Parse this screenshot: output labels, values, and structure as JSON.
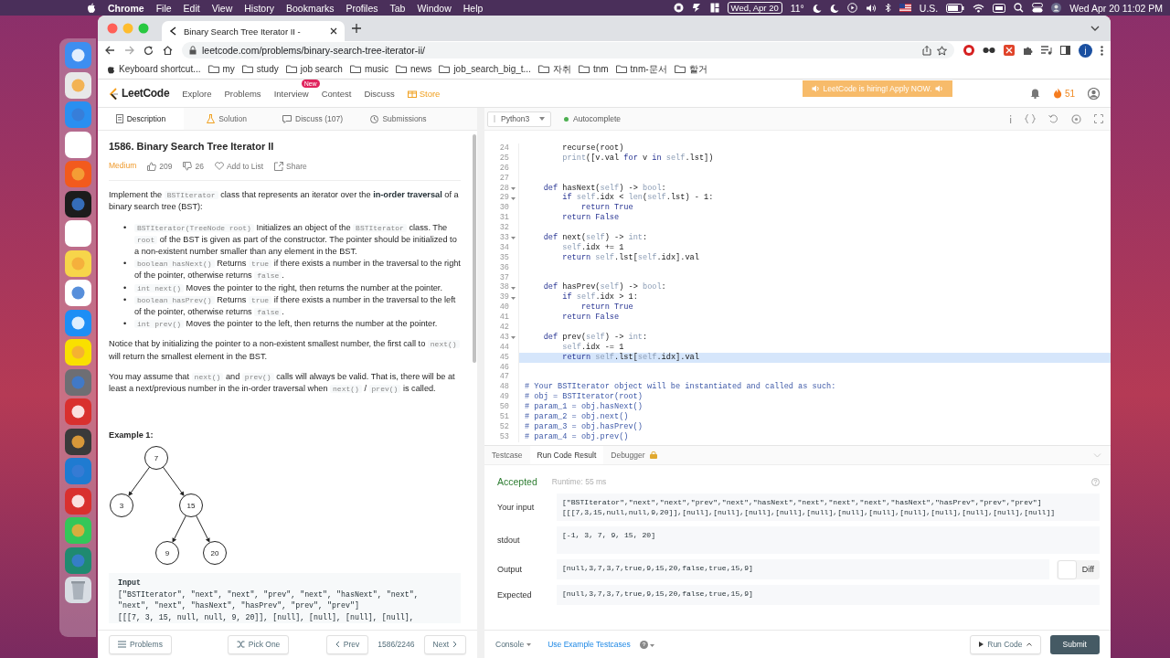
{
  "menu_bar": {
    "app": "Chrome",
    "items": [
      "File",
      "Edit",
      "View",
      "History",
      "Bookmarks",
      "Profiles",
      "Tab",
      "Window",
      "Help"
    ],
    "date_badge": "Wed, Apr 20",
    "weather": "11°",
    "input_source": "U.S.",
    "clock": "Wed Apr 20  11:02 PM"
  },
  "browser": {
    "tab_title": "Binary Search Tree Iterator II -",
    "url": "leetcode.com/problems/binary-search-tree-iterator-ii/",
    "profile": "j",
    "bookmarks": [
      {
        "kind": "page",
        "label": "Keyboard shortcut..."
      },
      {
        "kind": "folder",
        "label": "my"
      },
      {
        "kind": "folder",
        "label": "study"
      },
      {
        "kind": "folder",
        "label": "job search"
      },
      {
        "kind": "folder",
        "label": "music"
      },
      {
        "kind": "folder",
        "label": "news"
      },
      {
        "kind": "folder",
        "label": "job_search_big_t..."
      },
      {
        "kind": "folder",
        "label": "자취"
      },
      {
        "kind": "folder",
        "label": "tnm"
      },
      {
        "kind": "folder",
        "label": "tnm-문서"
      },
      {
        "kind": "folder",
        "label": "할거"
      }
    ]
  },
  "site_nav": {
    "logo": "LeetCode",
    "items": [
      {
        "kind": "link",
        "label": "Explore"
      },
      {
        "kind": "link",
        "label": "Problems"
      },
      {
        "kind": "link",
        "label": "Interview",
        "badge": "New"
      },
      {
        "kind": "link",
        "label": "Contest"
      },
      {
        "kind": "link",
        "label": "Discuss"
      },
      {
        "kind": "store",
        "label": "Store"
      }
    ],
    "banner": "LeetCode is hiring! Apply NOW.",
    "coins": "51"
  },
  "description_tabs": [
    {
      "label": "Description",
      "selected": true
    },
    {
      "label": "Solution",
      "selected": false
    },
    {
      "label": "Discuss (107)",
      "selected": false
    },
    {
      "label": "Submissions",
      "selected": false
    }
  ],
  "problem": {
    "title": "1586. Binary Search Tree Iterator II",
    "difficulty": "Medium",
    "likes": "209",
    "dislikes": "26",
    "add_to_list": "Add to List",
    "share": "Share",
    "body": [
      {
        "kind": "para",
        "segs": [
          {
            "kind": "text",
            "text": "Implement the "
          },
          {
            "kind": "code",
            "text": "BSTIterator"
          },
          {
            "kind": "text",
            "text": " class that represents an iterator over the "
          },
          {
            "kind": "strong",
            "text": "in-order traversal"
          },
          {
            "kind": "text",
            "text": " of a binary search tree (BST):"
          }
        ]
      },
      {
        "kind": "bullets",
        "marker": "•",
        "items": [
          [
            {
              "kind": "code",
              "text": "BSTIterator(TreeNode root)"
            },
            {
              "kind": "text",
              "text": " Initializes an object of the "
            },
            {
              "kind": "code",
              "text": "BSTIterator"
            },
            {
              "kind": "text",
              "text": " class. The "
            },
            {
              "kind": "code",
              "text": "root"
            },
            {
              "kind": "text",
              "text": " of the BST is given as part of the constructor. The pointer should be initialized to a non-existent number smaller than any element in the BST."
            }
          ],
          [
            {
              "kind": "code",
              "text": "boolean hasNext()"
            },
            {
              "kind": "text",
              "text": " Returns "
            },
            {
              "kind": "code",
              "text": "true"
            },
            {
              "kind": "text",
              "text": " if there exists a number in the traversal to the right of the pointer, otherwise returns "
            },
            {
              "kind": "code",
              "text": "false"
            },
            {
              "kind": "text",
              "text": "."
            }
          ],
          [
            {
              "kind": "code",
              "text": "int next()"
            },
            {
              "kind": "text",
              "text": " Moves the pointer to the right, then returns the number at the pointer."
            }
          ],
          [
            {
              "kind": "code",
              "text": "boolean hasPrev()"
            },
            {
              "kind": "text",
              "text": " Returns "
            },
            {
              "kind": "code",
              "text": "true"
            },
            {
              "kind": "text",
              "text": " if there exists a number in the traversal to the left of the pointer, otherwise returns "
            },
            {
              "kind": "code",
              "text": "false"
            },
            {
              "kind": "text",
              "text": "."
            }
          ],
          [
            {
              "kind": "code",
              "text": "int prev()"
            },
            {
              "kind": "text",
              "text": " Moves the pointer to the left, then returns the number at the pointer."
            }
          ]
        ]
      },
      {
        "kind": "para",
        "segs": [
          {
            "kind": "text",
            "text": "Notice that by initializing the pointer to a non-existent smallest number, the first call to "
          },
          {
            "kind": "code",
            "text": "next()"
          },
          {
            "kind": "text",
            "text": " will return the smallest element in the BST."
          }
        ]
      },
      {
        "kind": "para",
        "segs": [
          {
            "kind": "text",
            "text": "You may assume that "
          },
          {
            "kind": "code",
            "text": "next()"
          },
          {
            "kind": "text",
            "text": " and "
          },
          {
            "kind": "code",
            "text": "prev()"
          },
          {
            "kind": "text",
            "text": " calls will always be valid. That is, there will be at least a next/previous number in the in-order traversal when "
          },
          {
            "kind": "code",
            "text": "next()"
          },
          {
            "kind": "text",
            "text": " / "
          },
          {
            "kind": "code",
            "text": "prev()"
          },
          {
            "kind": "text",
            "text": " is called."
          }
        ]
      }
    ],
    "example_title": "Example 1:",
    "tree": {
      "label": "7",
      "children": [
        {
          "label": "3"
        },
        {
          "label": "15",
          "children": [
            {
              "label": "9"
            },
            {
              "label": "20"
            }
          ]
        }
      ]
    },
    "example_heading": "Input",
    "example_lines": [
      "[\"BSTIterator\", \"next\", \"next\", \"prev\", \"next\", \"hasNext\", \"next\",",
      "\"next\", \"next\", \"hasNext\", \"hasPrev\", \"prev\", \"prev\"]",
      "[[[7, 3, 15, null, null, 9, 20]], [null], [null], [null], [null],"
    ]
  },
  "left_footer": {
    "problems": "Problems",
    "pick_one": "Pick One",
    "prev": "Prev",
    "position": "1586/2246",
    "next": "Next"
  },
  "editor": {
    "language": "Python3",
    "autocomplete": "Autocomplete",
    "lines": [
      {
        "n": "24",
        "fold": false,
        "active": false,
        "segs": [
          {
            "kind": "plain",
            "text": "        recurse(root)"
          }
        ]
      },
      {
        "n": "25",
        "fold": false,
        "active": false,
        "segs": [
          {
            "kind": "builtin",
            "text": "        print"
          },
          {
            "kind": "plain",
            "text": "([v.val "
          },
          {
            "kind": "keyword",
            "text": "for"
          },
          {
            "kind": "plain",
            "text": " v "
          },
          {
            "kind": "keyword",
            "text": "in"
          },
          {
            "kind": "builtin",
            "text": " self"
          },
          {
            "kind": "plain",
            "text": ".lst])"
          }
        ]
      },
      {
        "n": "26",
        "fold": false,
        "active": false
      },
      {
        "n": "27",
        "fold": false,
        "active": false
      },
      {
        "n": "28",
        "fold": true,
        "active": false,
        "segs": [
          {
            "kind": "keyword",
            "text": "    def"
          },
          {
            "kind": "plain",
            "text": " hasNext("
          },
          {
            "kind": "builtin",
            "text": "self"
          },
          {
            "kind": "plain",
            "text": ") -> "
          },
          {
            "kind": "builtin",
            "text": "bool"
          },
          {
            "kind": "plain",
            "text": ":"
          }
        ]
      },
      {
        "n": "29",
        "fold": true,
        "active": false,
        "segs": [
          {
            "kind": "keyword",
            "text": "        if"
          },
          {
            "kind": "builtin",
            "text": " self"
          },
          {
            "kind": "plain",
            "text": ".idx < "
          },
          {
            "kind": "builtin",
            "text": "len"
          },
          {
            "kind": "plain",
            "text": "("
          },
          {
            "kind": "builtin",
            "text": "self"
          },
          {
            "kind": "plain",
            "text": ".lst) - 1:"
          }
        ]
      },
      {
        "n": "30",
        "fold": false,
        "active": false,
        "segs": [
          {
            "kind": "keyword",
            "text": "            return True"
          }
        ]
      },
      {
        "n": "31",
        "fold": false,
        "active": false,
        "segs": [
          {
            "kind": "keyword",
            "text": "        return False"
          }
        ]
      },
      {
        "n": "32",
        "fold": false,
        "active": false
      },
      {
        "n": "33",
        "fold": true,
        "active": false,
        "segs": [
          {
            "kind": "keyword",
            "text": "    def"
          },
          {
            "kind": "plain",
            "text": " next("
          },
          {
            "kind": "builtin",
            "text": "self"
          },
          {
            "kind": "plain",
            "text": ") -> "
          },
          {
            "kind": "builtin",
            "text": "int"
          },
          {
            "kind": "plain",
            "text": ":"
          }
        ]
      },
      {
        "n": "34",
        "fold": false,
        "active": false,
        "segs": [
          {
            "kind": "builtin",
            "text": "        self"
          },
          {
            "kind": "plain",
            "text": ".idx += 1"
          }
        ]
      },
      {
        "n": "35",
        "fold": false,
        "active": false,
        "segs": [
          {
            "kind": "keyword",
            "text": "        return"
          },
          {
            "kind": "builtin",
            "text": " self"
          },
          {
            "kind": "plain",
            "text": ".lst["
          },
          {
            "kind": "builtin",
            "text": "self"
          },
          {
            "kind": "plain",
            "text": ".idx].val"
          }
        ]
      },
      {
        "n": "36",
        "fold": false,
        "active": false
      },
      {
        "n": "37",
        "fold": false,
        "active": false
      },
      {
        "n": "38",
        "fold": true,
        "active": false,
        "segs": [
          {
            "kind": "keyword",
            "text": "    def"
          },
          {
            "kind": "plain",
            "text": " hasPrev("
          },
          {
            "kind": "builtin",
            "text": "self"
          },
          {
            "kind": "plain",
            "text": ") -> "
          },
          {
            "kind": "builtin",
            "text": "bool"
          },
          {
            "kind": "plain",
            "text": ":"
          }
        ]
      },
      {
        "n": "39",
        "fold": true,
        "active": false,
        "segs": [
          {
            "kind": "keyword",
            "text": "        if"
          },
          {
            "kind": "builtin",
            "text": " self"
          },
          {
            "kind": "plain",
            "text": ".idx > 1:"
          }
        ]
      },
      {
        "n": "40",
        "fold": false,
        "active": false,
        "segs": [
          {
            "kind": "keyword",
            "text": "            return True"
          }
        ]
      },
      {
        "n": "41",
        "fold": false,
        "active": false,
        "segs": [
          {
            "kind": "keyword",
            "text": "        return False"
          }
        ]
      },
      {
        "n": "42",
        "fold": false,
        "active": false
      },
      {
        "n": "43",
        "fold": true,
        "active": false,
        "segs": [
          {
            "kind": "keyword",
            "text": "    def"
          },
          {
            "kind": "plain",
            "text": " prev("
          },
          {
            "kind": "builtin",
            "text": "self"
          },
          {
            "kind": "plain",
            "text": ") -> "
          },
          {
            "kind": "builtin",
            "text": "int"
          },
          {
            "kind": "plain",
            "text": ":"
          }
        ]
      },
      {
        "n": "44",
        "fold": false,
        "active": false,
        "segs": [
          {
            "kind": "builtin",
            "text": "        self"
          },
          {
            "kind": "plain",
            "text": ".idx -= 1"
          }
        ]
      },
      {
        "n": "45",
        "fold": false,
        "active": true,
        "segs": [
          {
            "kind": "keyword",
            "text": "        return"
          },
          {
            "kind": "builtin",
            "text": " self"
          },
          {
            "kind": "plain",
            "text": ".lst["
          },
          {
            "kind": "builtin",
            "text": "self"
          },
          {
            "kind": "plain",
            "text": ".idx].val"
          }
        ]
      },
      {
        "n": "46",
        "fold": false,
        "active": false
      },
      {
        "n": "47",
        "fold": false,
        "active": false
      },
      {
        "n": "48",
        "fold": false,
        "active": false,
        "segs": [
          {
            "kind": "comment",
            "text": "# Your BSTIterator object will be instantiated and called as such:"
          }
        ]
      },
      {
        "n": "49",
        "fold": false,
        "active": false,
        "segs": [
          {
            "kind": "comment",
            "text": "# obj = BSTIterator(root)"
          }
        ]
      },
      {
        "n": "50",
        "fold": false,
        "active": false,
        "segs": [
          {
            "kind": "comment",
            "text": "# param_1 = obj.hasNext()"
          }
        ]
      },
      {
        "n": "51",
        "fold": false,
        "active": false,
        "segs": [
          {
            "kind": "comment",
            "text": "# param_2 = obj.next()"
          }
        ]
      },
      {
        "n": "52",
        "fold": false,
        "active": false,
        "segs": [
          {
            "kind": "comment",
            "text": "# param_3 = obj.hasPrev()"
          }
        ]
      },
      {
        "n": "53",
        "fold": false,
        "active": false,
        "segs": [
          {
            "kind": "comment",
            "text": "# param_4 = obj.prev()"
          }
        ]
      }
    ]
  },
  "result_tabs": [
    {
      "label": "Testcase",
      "selected": false,
      "locked": false
    },
    {
      "label": "Run Code Result",
      "selected": true,
      "locked": false
    },
    {
      "label": "Debugger",
      "selected": false,
      "locked": true
    }
  ],
  "result": {
    "status": "Accepted",
    "runtime": "Runtime: 55 ms",
    "rows": [
      {
        "label": "Your input",
        "lines": [
          "[\"BSTIterator\",\"next\",\"next\",\"prev\",\"next\",\"hasNext\",\"next\",\"next\",\"next\",\"hasNext\",\"hasPrev\",\"prev\",\"prev\"]",
          "[[[7,3,15,null,null,9,20]],[null],[null],[null],[null],[null],[null],[null],[null],[null],[null],[null],[null]]"
        ]
      },
      {
        "label": "stdout",
        "lines": [
          "[-1, 3, 7, 9, 15, 20]"
        ]
      },
      {
        "label": "Output",
        "lines": [
          "[null,3,7,3,7,true,9,15,20,false,true,15,9]"
        ],
        "diff": {
          "label": "Diff",
          "on": false
        }
      },
      {
        "label": "Expected",
        "lines": [
          "[null,3,7,3,7,true,9,15,20,false,true,15,9]"
        ]
      }
    ]
  },
  "right_footer": {
    "console": "Console",
    "testcases": "Use Example Testcases",
    "run": "Run Code",
    "submit": "Submit"
  }
}
